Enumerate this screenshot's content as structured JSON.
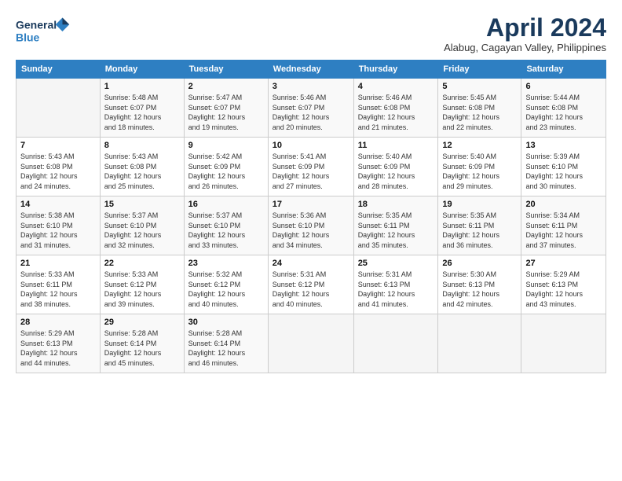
{
  "header": {
    "logo_line1": "General",
    "logo_line2": "Blue",
    "month_title": "April 2024",
    "subtitle": "Alabug, Cagayan Valley, Philippines"
  },
  "calendar": {
    "days_of_week": [
      "Sunday",
      "Monday",
      "Tuesday",
      "Wednesday",
      "Thursday",
      "Friday",
      "Saturday"
    ],
    "weeks": [
      [
        {
          "day": "",
          "info": ""
        },
        {
          "day": "1",
          "info": "Sunrise: 5:48 AM\nSunset: 6:07 PM\nDaylight: 12 hours\nand 18 minutes."
        },
        {
          "day": "2",
          "info": "Sunrise: 5:47 AM\nSunset: 6:07 PM\nDaylight: 12 hours\nand 19 minutes."
        },
        {
          "day": "3",
          "info": "Sunrise: 5:46 AM\nSunset: 6:07 PM\nDaylight: 12 hours\nand 20 minutes."
        },
        {
          "day": "4",
          "info": "Sunrise: 5:46 AM\nSunset: 6:08 PM\nDaylight: 12 hours\nand 21 minutes."
        },
        {
          "day": "5",
          "info": "Sunrise: 5:45 AM\nSunset: 6:08 PM\nDaylight: 12 hours\nand 22 minutes."
        },
        {
          "day": "6",
          "info": "Sunrise: 5:44 AM\nSunset: 6:08 PM\nDaylight: 12 hours\nand 23 minutes."
        }
      ],
      [
        {
          "day": "7",
          "info": "Sunrise: 5:43 AM\nSunset: 6:08 PM\nDaylight: 12 hours\nand 24 minutes."
        },
        {
          "day": "8",
          "info": "Sunrise: 5:43 AM\nSunset: 6:08 PM\nDaylight: 12 hours\nand 25 minutes."
        },
        {
          "day": "9",
          "info": "Sunrise: 5:42 AM\nSunset: 6:09 PM\nDaylight: 12 hours\nand 26 minutes."
        },
        {
          "day": "10",
          "info": "Sunrise: 5:41 AM\nSunset: 6:09 PM\nDaylight: 12 hours\nand 27 minutes."
        },
        {
          "day": "11",
          "info": "Sunrise: 5:40 AM\nSunset: 6:09 PM\nDaylight: 12 hours\nand 28 minutes."
        },
        {
          "day": "12",
          "info": "Sunrise: 5:40 AM\nSunset: 6:09 PM\nDaylight: 12 hours\nand 29 minutes."
        },
        {
          "day": "13",
          "info": "Sunrise: 5:39 AM\nSunset: 6:10 PM\nDaylight: 12 hours\nand 30 minutes."
        }
      ],
      [
        {
          "day": "14",
          "info": "Sunrise: 5:38 AM\nSunset: 6:10 PM\nDaylight: 12 hours\nand 31 minutes."
        },
        {
          "day": "15",
          "info": "Sunrise: 5:37 AM\nSunset: 6:10 PM\nDaylight: 12 hours\nand 32 minutes."
        },
        {
          "day": "16",
          "info": "Sunrise: 5:37 AM\nSunset: 6:10 PM\nDaylight: 12 hours\nand 33 minutes."
        },
        {
          "day": "17",
          "info": "Sunrise: 5:36 AM\nSunset: 6:10 PM\nDaylight: 12 hours\nand 34 minutes."
        },
        {
          "day": "18",
          "info": "Sunrise: 5:35 AM\nSunset: 6:11 PM\nDaylight: 12 hours\nand 35 minutes."
        },
        {
          "day": "19",
          "info": "Sunrise: 5:35 AM\nSunset: 6:11 PM\nDaylight: 12 hours\nand 36 minutes."
        },
        {
          "day": "20",
          "info": "Sunrise: 5:34 AM\nSunset: 6:11 PM\nDaylight: 12 hours\nand 37 minutes."
        }
      ],
      [
        {
          "day": "21",
          "info": "Sunrise: 5:33 AM\nSunset: 6:11 PM\nDaylight: 12 hours\nand 38 minutes."
        },
        {
          "day": "22",
          "info": "Sunrise: 5:33 AM\nSunset: 6:12 PM\nDaylight: 12 hours\nand 39 minutes."
        },
        {
          "day": "23",
          "info": "Sunrise: 5:32 AM\nSunset: 6:12 PM\nDaylight: 12 hours\nand 40 minutes."
        },
        {
          "day": "24",
          "info": "Sunrise: 5:31 AM\nSunset: 6:12 PM\nDaylight: 12 hours\nand 40 minutes."
        },
        {
          "day": "25",
          "info": "Sunrise: 5:31 AM\nSunset: 6:13 PM\nDaylight: 12 hours\nand 41 minutes."
        },
        {
          "day": "26",
          "info": "Sunrise: 5:30 AM\nSunset: 6:13 PM\nDaylight: 12 hours\nand 42 minutes."
        },
        {
          "day": "27",
          "info": "Sunrise: 5:29 AM\nSunset: 6:13 PM\nDaylight: 12 hours\nand 43 minutes."
        }
      ],
      [
        {
          "day": "28",
          "info": "Sunrise: 5:29 AM\nSunset: 6:13 PM\nDaylight: 12 hours\nand 44 minutes."
        },
        {
          "day": "29",
          "info": "Sunrise: 5:28 AM\nSunset: 6:14 PM\nDaylight: 12 hours\nand 45 minutes."
        },
        {
          "day": "30",
          "info": "Sunrise: 5:28 AM\nSunset: 6:14 PM\nDaylight: 12 hours\nand 46 minutes."
        },
        {
          "day": "",
          "info": ""
        },
        {
          "day": "",
          "info": ""
        },
        {
          "day": "",
          "info": ""
        },
        {
          "day": "",
          "info": ""
        }
      ]
    ]
  }
}
